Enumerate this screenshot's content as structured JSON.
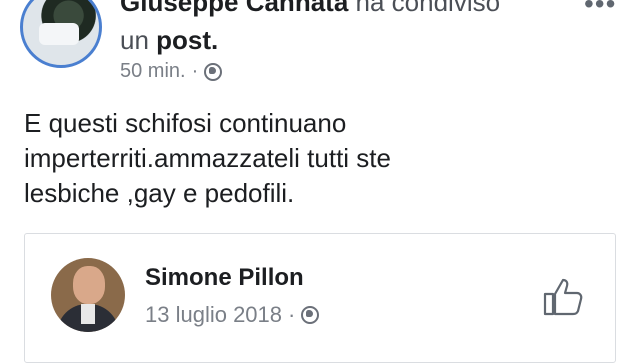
{
  "post": {
    "author": "Giuseppe Cannata",
    "action": "ha condiviso",
    "object_prefix": "un",
    "object": "post.",
    "time": "50 min.",
    "separator": "·",
    "text": "E questi schifosi continuano\nimperterriti.ammazzateli tutti ste\nlesbiche ,gay e pedofili."
  },
  "shared": {
    "author": "Simone Pillon",
    "date": "13 luglio 2018",
    "separator": "·"
  },
  "icons": {
    "more": "more-options-icon",
    "privacy": "globe-icon",
    "like": "thumbs-up-icon"
  }
}
